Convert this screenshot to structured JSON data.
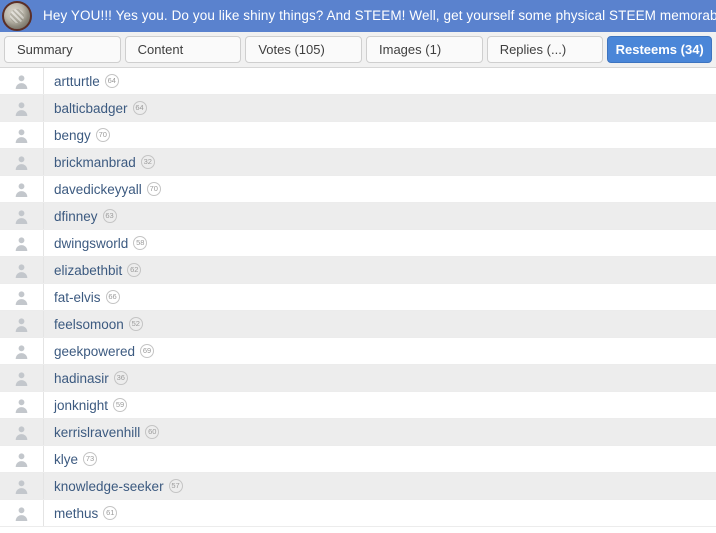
{
  "banner": {
    "avatar_icon": "coin-avatar",
    "text": "Hey YOU!!! Yes you. Do you like shiny things? And STEEM! Well, get yourself some physical STEEM memorabilia before",
    "background_color": "#5a82ce"
  },
  "tabs": [
    {
      "label": "Summary",
      "active": false
    },
    {
      "label": "Content",
      "active": false
    },
    {
      "label": "Votes (105)",
      "active": false
    },
    {
      "label": "Images (1)",
      "active": false
    },
    {
      "label": "Replies (...)",
      "active": false
    },
    {
      "label": "Resteems (34)",
      "active": true
    }
  ],
  "active_tab_color": "#4a86d8",
  "username_color": "#3c5a80",
  "resteems": [
    {
      "avatar_icon": "person-icon",
      "username": "artturtle",
      "reputation": "64"
    },
    {
      "avatar_icon": "person-icon",
      "username": "balticbadger",
      "reputation": "64"
    },
    {
      "avatar_icon": "person-icon",
      "username": "bengy",
      "reputation": "70"
    },
    {
      "avatar_icon": "person-icon",
      "username": "brickmanbrad",
      "reputation": "32"
    },
    {
      "avatar_icon": "person-icon",
      "username": "davedickeyyall",
      "reputation": "70"
    },
    {
      "avatar_icon": "person-icon",
      "username": "dfinney",
      "reputation": "63"
    },
    {
      "avatar_icon": "person-icon",
      "username": "dwingsworld",
      "reputation": "58"
    },
    {
      "avatar_icon": "person-icon",
      "username": "elizabethbit",
      "reputation": "62"
    },
    {
      "avatar_icon": "person-icon",
      "username": "fat-elvis",
      "reputation": "66"
    },
    {
      "avatar_icon": "person-icon",
      "username": "feelsomoon",
      "reputation": "52"
    },
    {
      "avatar_icon": "person-icon",
      "username": "geekpowered",
      "reputation": "69"
    },
    {
      "avatar_icon": "person-icon",
      "username": "hadinasir",
      "reputation": "36"
    },
    {
      "avatar_icon": "person-icon",
      "username": "jonknight",
      "reputation": "59"
    },
    {
      "avatar_icon": "person-icon",
      "username": "kerrislravenhill",
      "reputation": "60"
    },
    {
      "avatar_icon": "person-icon",
      "username": "klye",
      "reputation": "73"
    },
    {
      "avatar_icon": "person-icon",
      "username": "knowledge-seeker",
      "reputation": "57"
    },
    {
      "avatar_icon": "person-icon",
      "username": "methus",
      "reputation": "61"
    }
  ]
}
